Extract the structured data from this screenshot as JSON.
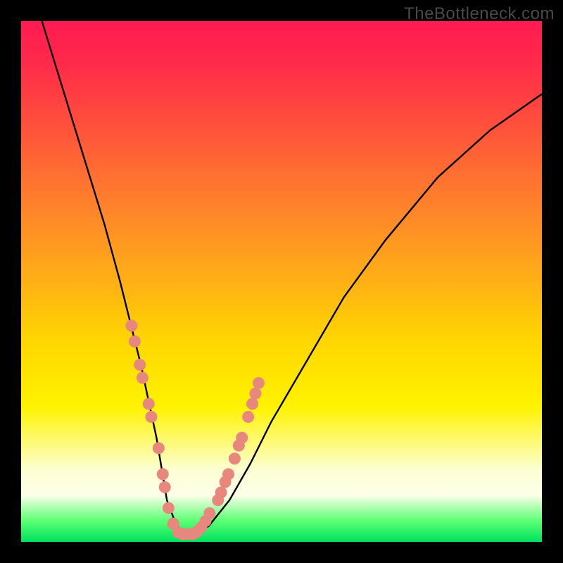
{
  "watermark": "TheBottleneck.com",
  "chart_data": {
    "type": "line",
    "title": "",
    "xlabel": "",
    "ylabel": "",
    "xlim": [
      0,
      100
    ],
    "ylim": [
      0,
      100
    ],
    "legend": false,
    "grid": false,
    "series": [
      {
        "name": "curve",
        "color": "#000000",
        "x": [
          4,
          8,
          12,
          16,
          19,
          21,
          23,
          24.5,
          26,
          27,
          28,
          29.5,
          31,
          33,
          36,
          40,
          44,
          48,
          55,
          62,
          70,
          80,
          90,
          100
        ],
        "values": [
          100,
          87,
          74,
          61,
          50,
          42,
          34,
          27,
          20,
          14,
          8,
          4,
          1.5,
          1.5,
          3,
          8,
          15,
          23,
          35,
          47,
          58,
          70,
          79,
          86
        ]
      }
    ],
    "marker_overlays": [
      {
        "name": "pink-dots-left",
        "color": "#e8877d",
        "points": [
          {
            "x": 21.2,
            "y": 41.5
          },
          {
            "x": 21.8,
            "y": 38.5
          },
          {
            "x": 22.8,
            "y": 34.0
          },
          {
            "x": 23.3,
            "y": 31.5
          },
          {
            "x": 24.5,
            "y": 26.5
          },
          {
            "x": 25.0,
            "y": 24.0
          },
          {
            "x": 26.4,
            "y": 18.0
          },
          {
            "x": 27.2,
            "y": 13.0
          },
          {
            "x": 27.6,
            "y": 10.5
          },
          {
            "x": 28.3,
            "y": 6.5
          },
          {
            "x": 29.2,
            "y": 3.5
          },
          {
            "x": 30.2,
            "y": 1.8
          },
          {
            "x": 31.0,
            "y": 1.5
          },
          {
            "x": 32.0,
            "y": 1.5
          },
          {
            "x": 33.0,
            "y": 1.5
          }
        ]
      },
      {
        "name": "pink-dots-right",
        "color": "#e8877d",
        "points": [
          {
            "x": 33.8,
            "y": 2.0
          },
          {
            "x": 34.6,
            "y": 2.8
          },
          {
            "x": 35.4,
            "y": 4.0
          },
          {
            "x": 36.2,
            "y": 5.5
          },
          {
            "x": 37.8,
            "y": 8.0
          },
          {
            "x": 38.4,
            "y": 9.5
          },
          {
            "x": 39.2,
            "y": 11.5
          },
          {
            "x": 39.8,
            "y": 13.0
          },
          {
            "x": 41.0,
            "y": 16.0
          },
          {
            "x": 41.8,
            "y": 18.5
          },
          {
            "x": 42.4,
            "y": 20.0
          },
          {
            "x": 43.6,
            "y": 24.0
          },
          {
            "x": 44.4,
            "y": 26.5
          },
          {
            "x": 45.0,
            "y": 28.5
          },
          {
            "x": 45.6,
            "y": 30.5
          }
        ]
      }
    ],
    "background_gradient": {
      "stops": [
        {
          "pos": 0.0,
          "color": "#ff1a52"
        },
        {
          "pos": 0.5,
          "color": "#ffb015"
        },
        {
          "pos": 0.74,
          "color": "#fff200"
        },
        {
          "pos": 0.91,
          "color": "#fdffe8"
        },
        {
          "pos": 1.0,
          "color": "#00e05e"
        }
      ]
    }
  }
}
